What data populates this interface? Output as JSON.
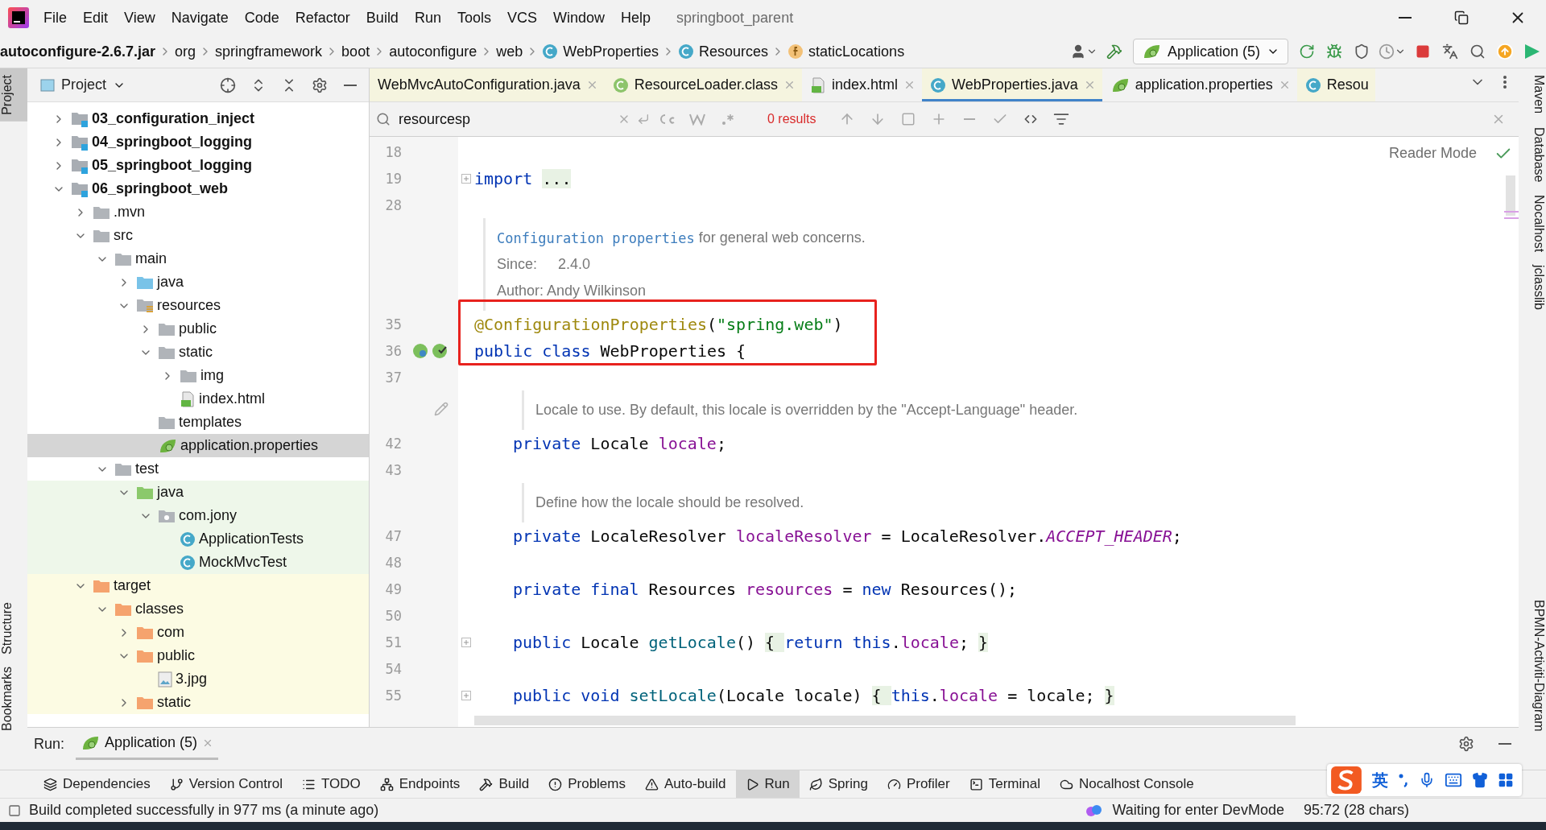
{
  "menu_bar": {
    "items": [
      "File",
      "Edit",
      "View",
      "Navigate",
      "Code",
      "Refactor",
      "Build",
      "Run",
      "Tools",
      "VCS",
      "Window",
      "Help"
    ],
    "title": "springboot_parent"
  },
  "breadcrumbs": [
    {
      "label": "autoconfigure-2.6.7.jar",
      "kind": "jar"
    },
    {
      "label": "org",
      "kind": "package"
    },
    {
      "label": "springframework",
      "kind": "package"
    },
    {
      "label": "boot",
      "kind": "package"
    },
    {
      "label": "autoconfigure",
      "kind": "package"
    },
    {
      "label": "web",
      "kind": "package"
    },
    {
      "label": "WebProperties",
      "kind": "class"
    },
    {
      "label": "Resources",
      "kind": "class"
    },
    {
      "label": "staticLocations",
      "kind": "field"
    }
  ],
  "run_config": {
    "label": "Application (5)"
  },
  "left_strip": [
    {
      "label": "Project",
      "selected": true
    },
    {
      "label": "Structure",
      "selected": false
    },
    {
      "label": "Bookmarks",
      "selected": false
    }
  ],
  "project_panel": {
    "title": "Project",
    "tree": [
      {
        "label": "03_configuration_inject",
        "kind": "module",
        "expanded": false,
        "selected": false
      },
      {
        "label": "04_springboot_logging",
        "kind": "module",
        "expanded": false,
        "selected": false
      },
      {
        "label": "05_springboot_logging",
        "kind": "module",
        "expanded": false,
        "selected": false
      },
      {
        "label": "06_springboot_web",
        "kind": "module",
        "expanded": true,
        "selected": false,
        "children": [
          {
            "label": ".mvn",
            "kind": "folder",
            "expanded": false,
            "selected": false
          },
          {
            "label": "src",
            "kind": "folder",
            "expanded": true,
            "selected": false,
            "children": [
              {
                "label": "main",
                "kind": "folder",
                "expanded": true,
                "selected": false,
                "children": [
                  {
                    "label": "java",
                    "kind": "source",
                    "expanded": false,
                    "selected": false
                  },
                  {
                    "label": "resources",
                    "kind": "resources",
                    "expanded": true,
                    "selected": false,
                    "children": [
                      {
                        "label": "public",
                        "kind": "folder",
                        "expanded": false,
                        "selected": false
                      },
                      {
                        "label": "static",
                        "kind": "folder",
                        "expanded": true,
                        "selected": false,
                        "children": [
                          {
                            "label": "img",
                            "kind": "folder",
                            "expanded": false,
                            "selected": false
                          },
                          {
                            "label": "index.html",
                            "kind": "html",
                            "selected": false
                          }
                        ]
                      },
                      {
                        "label": "templates",
                        "kind": "folder",
                        "selected": false
                      },
                      {
                        "label": "application.properties",
                        "kind": "spring",
                        "selected": true
                      }
                    ]
                  }
                ]
              },
              {
                "label": "test",
                "kind": "folder",
                "expanded": true,
                "selected": false,
                "children": [
                  {
                    "label": "java",
                    "kind": "test-source",
                    "expanded": true,
                    "test": true,
                    "selected": false,
                    "children": [
                      {
                        "label": "com.jony",
                        "kind": "package",
                        "expanded": true,
                        "selected": false,
                        "children": [
                          {
                            "label": "ApplicationTests",
                            "kind": "class",
                            "selected": false
                          },
                          {
                            "label": "MockMvcTest",
                            "kind": "class",
                            "selected": false
                          }
                        ]
                      }
                    ]
                  }
                ]
              }
            ]
          },
          {
            "label": "target",
            "kind": "excluded-folder",
            "expanded": true,
            "excluded": true,
            "selected": false,
            "children": [
              {
                "label": "classes",
                "kind": "excluded-folder",
                "expanded": true,
                "selected": false,
                "children": [
                  {
                    "label": "com",
                    "kind": "excluded-folder",
                    "expanded": false,
                    "selected": false
                  },
                  {
                    "label": "public",
                    "kind": "excluded-folder",
                    "expanded": true,
                    "selected": false,
                    "children": [
                      {
                        "label": "3.jpg",
                        "kind": "image",
                        "selected": false
                      }
                    ]
                  },
                  {
                    "label": "static",
                    "kind": "excluded-folder",
                    "expanded": false,
                    "selected": false
                  }
                ]
              }
            ]
          }
        ]
      }
    ]
  },
  "editor_tabs": [
    {
      "label": "WebMvcAutoConfiguration.java",
      "kind": "plain",
      "library": true,
      "closable": true,
      "selected": false
    },
    {
      "label": "ResourceLoader.class",
      "kind": "interface",
      "library": true,
      "closable": true,
      "selected": false
    },
    {
      "label": "index.html",
      "kind": "html",
      "library": false,
      "closable": true,
      "selected": false
    },
    {
      "label": "WebProperties.java",
      "kind": "class",
      "library": true,
      "closable": true,
      "selected": true
    },
    {
      "label": "application.properties",
      "kind": "spring",
      "library": false,
      "closable": true,
      "selected": false
    },
    {
      "label": "Resou",
      "kind": "class",
      "library": true,
      "closable": false,
      "selected": false
    }
  ],
  "search": {
    "value": "resourcesp",
    "results": "0 results"
  },
  "reader_mode": "Reader Mode",
  "editor": {
    "lines": [
      {
        "kind": "code",
        "number": "18"
      },
      {
        "kind": "code",
        "number": "19",
        "foldable": true,
        "tokens": [
          {
            "kind": "keyword",
            "text": "import "
          },
          {
            "kind": "folded",
            "text": "..."
          }
        ]
      },
      {
        "kind": "code",
        "number": "28"
      },
      {
        "kind": "doc",
        "lines": [
          [
            {
              "kind": "link",
              "text": "Configuration properties"
            },
            {
              "kind": "text",
              "text": " for general web concerns."
            }
          ],
          [
            {
              "kind": "label",
              "text": "Since:"
            },
            {
              "kind": "text",
              "text": "2.4.0"
            }
          ],
          [
            {
              "kind": "text",
              "text": "Author: Andy Wilkinson"
            }
          ]
        ]
      },
      {
        "kind": "code",
        "number": "35",
        "boxed": true,
        "tokens": [
          {
            "kind": "annotation",
            "text": "@ConfigurationProperties"
          },
          {
            "kind": "plain",
            "text": "("
          },
          {
            "kind": "string",
            "text": "\"spring.web\""
          },
          {
            "kind": "plain",
            "text": ")"
          }
        ]
      },
      {
        "kind": "code",
        "number": "36",
        "boxed": true,
        "markers": true,
        "tokens": [
          {
            "kind": "keyword",
            "text": "public class"
          },
          {
            "kind": "plain",
            "text": " WebProperties {"
          }
        ],
        "children": [
          {
            "kind": "code",
            "number": "37"
          },
          {
            "kind": "doc",
            "edit": true,
            "lines": [
              [
                {
                  "kind": "text",
                  "text": "Locale to use. By default, this locale is overridden by the \"Accept-Language\" header."
                }
              ]
            ]
          },
          {
            "kind": "code",
            "number": "42",
            "tokens": [
              {
                "kind": "keyword",
                "text": "private"
              },
              {
                "kind": "plain",
                "text": " Locale "
              },
              {
                "kind": "field",
                "text": "locale"
              },
              {
                "kind": "plain",
                "text": ";"
              }
            ]
          },
          {
            "kind": "code",
            "number": "43"
          },
          {
            "kind": "doc",
            "lines": [
              [
                {
                  "kind": "text",
                  "text": "Define how the locale should be resolved."
                }
              ]
            ]
          },
          {
            "kind": "code",
            "number": "47",
            "tokens": [
              {
                "kind": "keyword",
                "text": "private"
              },
              {
                "kind": "plain",
                "text": " LocaleResolver "
              },
              {
                "kind": "field",
                "text": "localeResolver"
              },
              {
                "kind": "plain",
                "text": " = LocaleResolver."
              },
              {
                "kind": "constant",
                "text": "ACCEPT_HEADER"
              },
              {
                "kind": "plain",
                "text": ";"
              }
            ]
          },
          {
            "kind": "code",
            "number": "48"
          },
          {
            "kind": "code",
            "number": "49",
            "tokens": [
              {
                "kind": "keyword",
                "text": "private final"
              },
              {
                "kind": "plain",
                "text": " Resources "
              },
              {
                "kind": "field",
                "text": "resources"
              },
              {
                "kind": "plain",
                "text": " = "
              },
              {
                "kind": "keyword",
                "text": "new"
              },
              {
                "kind": "plain",
                "text": " Resources();"
              }
            ]
          },
          {
            "kind": "code",
            "number": "50"
          },
          {
            "kind": "code",
            "number": "51",
            "foldable": true,
            "tokens": [
              {
                "kind": "keyword",
                "text": "public"
              },
              {
                "kind": "plain",
                "text": " Locale "
              },
              {
                "kind": "method",
                "text": "getLocale"
              },
              {
                "kind": "plain",
                "text": "() "
              },
              {
                "kind": "folded",
                "text": "{ "
              },
              {
                "kind": "keyword",
                "text": "return this"
              },
              {
                "kind": "plain",
                "text": "."
              },
              {
                "kind": "field",
                "text": "locale"
              },
              {
                "kind": "plain",
                "text": "; "
              },
              {
                "kind": "folded",
                "text": "}"
              }
            ]
          },
          {
            "kind": "code",
            "number": "54"
          },
          {
            "kind": "code",
            "number": "55",
            "foldable": true,
            "tokens": [
              {
                "kind": "keyword",
                "text": "public void"
              },
              {
                "kind": "method",
                "text": " setLocale"
              },
              {
                "kind": "plain",
                "text": "(Locale locale) "
              },
              {
                "kind": "folded",
                "text": "{ "
              },
              {
                "kind": "keyword",
                "text": "this"
              },
              {
                "kind": "plain",
                "text": "."
              },
              {
                "kind": "field",
                "text": "locale"
              },
              {
                "kind": "plain",
                "text": " = locale; "
              },
              {
                "kind": "folded",
                "text": "}"
              }
            ]
          }
        ]
      }
    ]
  },
  "right_strip": [
    "Maven",
    "Database",
    "Nocalhost",
    "jclasslib",
    "BPMN-Activiti-Diagram"
  ],
  "run_bar": {
    "label": "Run:",
    "tab": "Application (5)"
  },
  "tool_windows": [
    {
      "label": "Dependencies",
      "kind": "layers",
      "selected": false
    },
    {
      "label": "Version Control",
      "kind": "branch",
      "selected": false
    },
    {
      "label": "TODO",
      "kind": "list",
      "selected": false
    },
    {
      "label": "Endpoints",
      "kind": "network",
      "selected": false
    },
    {
      "label": "Build",
      "kind": "hammer",
      "selected": false
    },
    {
      "label": "Problems",
      "kind": "alert",
      "selected": false
    },
    {
      "label": "Auto-build",
      "kind": "warning",
      "selected": false
    },
    {
      "label": "Run",
      "kind": "play",
      "selected": true
    },
    {
      "label": "Spring",
      "kind": "leaf",
      "selected": false
    },
    {
      "label": "Profiler",
      "kind": "gauge",
      "selected": false
    },
    {
      "label": "Terminal",
      "kind": "terminal",
      "selected": false
    },
    {
      "label": "Nocalhost Console",
      "kind": "cloud",
      "selected": false
    }
  ],
  "status_bar": {
    "message": "Build completed successfully in 977 ms (a minute ago)",
    "devmode": "Waiting for enter DevMode",
    "position": "95:72 (28 chars)"
  },
  "ime_bar": {
    "language": "英"
  }
}
